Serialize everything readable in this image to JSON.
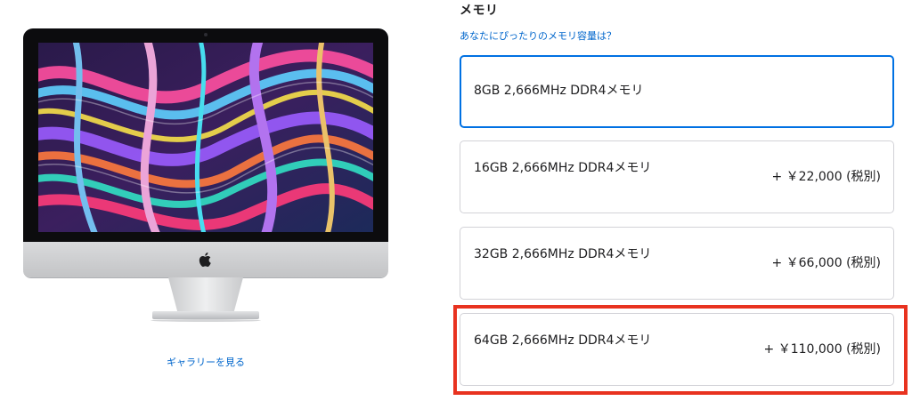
{
  "product_image": {
    "alt": "iMac",
    "gallery_link": "ギャラリーを見る"
  },
  "memory": {
    "title": "メモリ",
    "help_link": "あなたにぴったりのメモリ容量は？",
    "options": [
      {
        "label": "8GB 2,666MHz DDR4メモリ",
        "price": "",
        "selected": true
      },
      {
        "label": "16GB 2,666MHz DDR4メモリ",
        "price": "+ ￥22,000 (税別)",
        "selected": false
      },
      {
        "label": "32GB 2,666MHz DDR4メモリ",
        "price": "+ ￥66,000 (税別)",
        "selected": false
      },
      {
        "label": "64GB 2,666MHz DDR4メモリ",
        "price": "+ ￥110,000 (税別)",
        "selected": false,
        "highlighted": true
      }
    ]
  },
  "colors": {
    "link": "#0066cc",
    "selected_border": "#0071e3",
    "highlight": "#e8321f",
    "text": "#1d1d1f",
    "border": "#d2d2d7"
  }
}
